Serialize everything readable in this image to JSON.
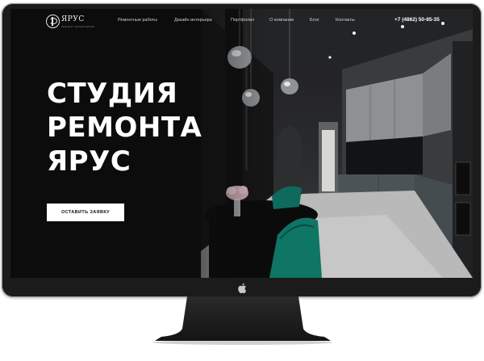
{
  "brand": {
    "name": "ЯРУС",
    "tagline": "РЕМОНТ ИНТЕРЬЕРОВ"
  },
  "nav": {
    "items": [
      {
        "label": "Ремонтные работы"
      },
      {
        "label": "Дизайн интерьера"
      },
      {
        "label": "Портфолио"
      },
      {
        "label": "О компании"
      },
      {
        "label": "Блог"
      },
      {
        "label": "Контакты"
      }
    ],
    "phone": "+7 (4862) 50-85-35"
  },
  "hero": {
    "title_lines": [
      "СТУДИЯ",
      "РЕМОНТА",
      "ЯРУС"
    ],
    "cta_label": "ОСТАВИТЬ ЗАЯВКУ"
  },
  "colors": {
    "page_bg": "#0c0c0c",
    "text": "#ffffff",
    "accent_chair": "#0f6b5e",
    "button_bg": "#ffffff"
  },
  "icons": {
    "logo": "yarus-logo-icon",
    "device": "apple-icon"
  }
}
